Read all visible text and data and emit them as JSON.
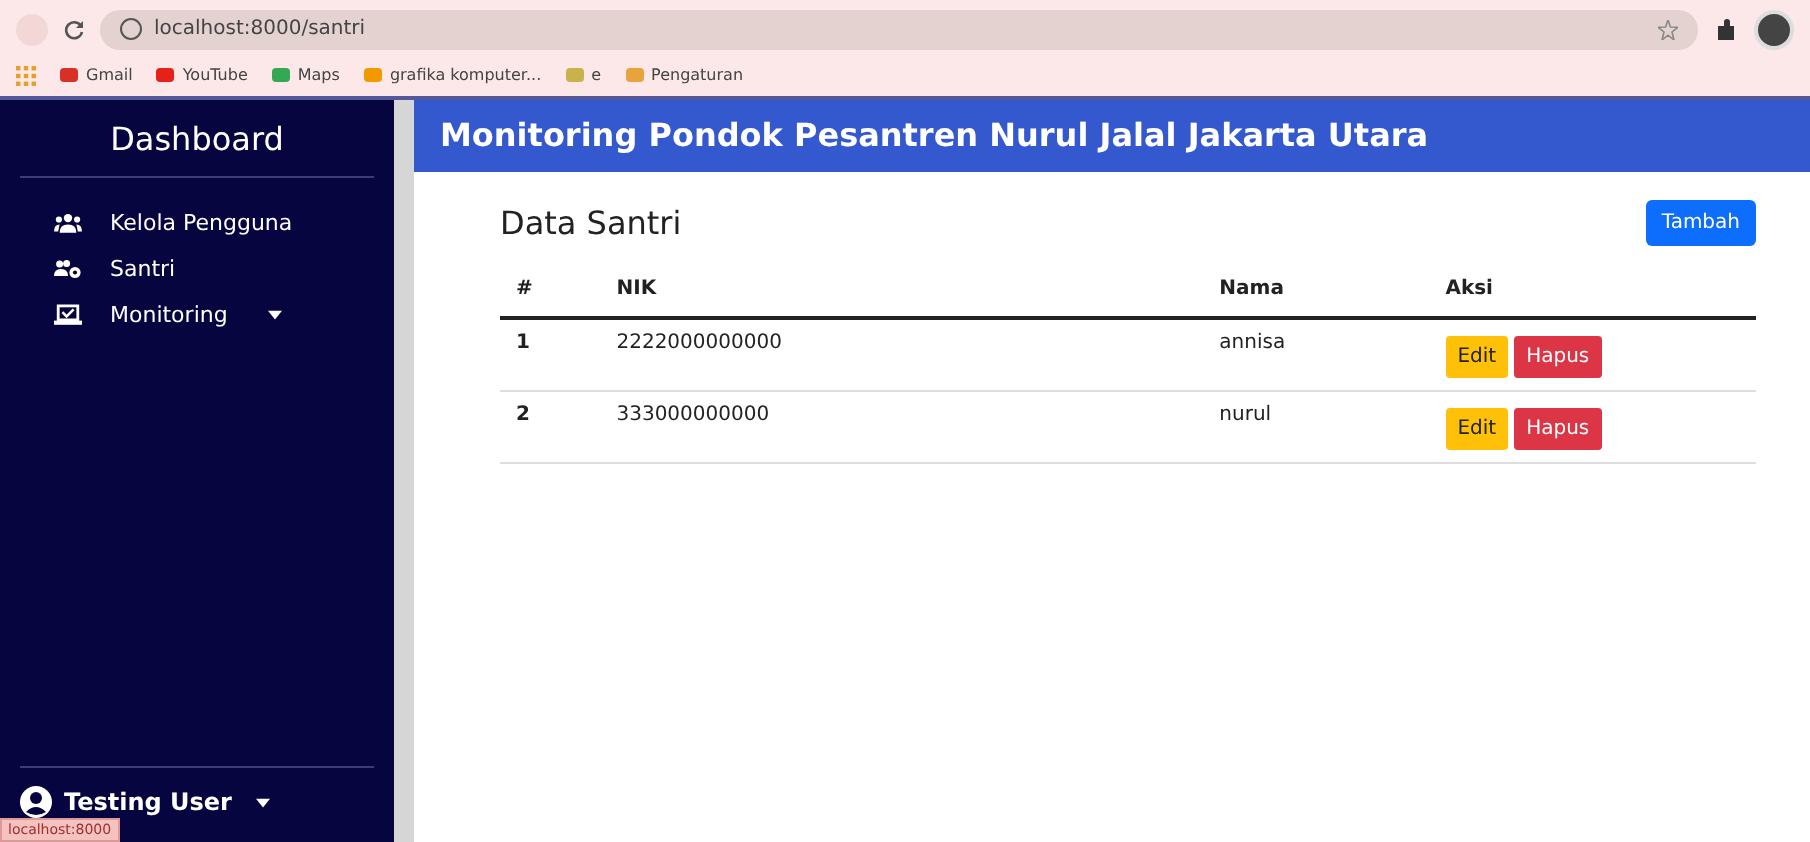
{
  "browser": {
    "url": "localhost:8000/santri",
    "bookmarks": [
      {
        "label": "Gmail",
        "color": "#d93025"
      },
      {
        "label": "YouTube",
        "color": "#e62117"
      },
      {
        "label": "Maps",
        "color": "#34a853"
      },
      {
        "label": "grafika komputer...",
        "color": "#f29900"
      },
      {
        "label": "e",
        "color": "#c7b34a"
      },
      {
        "label": "Pengaturan",
        "color": "#e8a33d"
      }
    ]
  },
  "sidebar": {
    "title": "Dashboard",
    "items": [
      {
        "label": "Kelola Pengguna",
        "kind": "users",
        "dropdown": false
      },
      {
        "label": "Santri",
        "kind": "users-gear",
        "dropdown": false
      },
      {
        "label": "Monitoring",
        "kind": "laptop",
        "dropdown": true
      }
    ],
    "user": "Testing User"
  },
  "header": {
    "title": "Monitoring Pondok Pesantren Nurul Jalal Jakarta Utara"
  },
  "content": {
    "title": "Data Santri",
    "add_button": "Tambah",
    "table": {
      "columns": [
        "#",
        "NIK",
        "Nama",
        "Aksi"
      ],
      "rows": [
        {
          "no": "1",
          "nik": "2222000000000",
          "nama": "annisa",
          "actions": [
            "Edit",
            "Hapus"
          ]
        },
        {
          "no": "2",
          "nik": "333000000000",
          "nama": "nurul",
          "actions": [
            "Edit",
            "Hapus"
          ]
        }
      ]
    }
  },
  "status_bar": {
    "text": "localhost:8000"
  }
}
